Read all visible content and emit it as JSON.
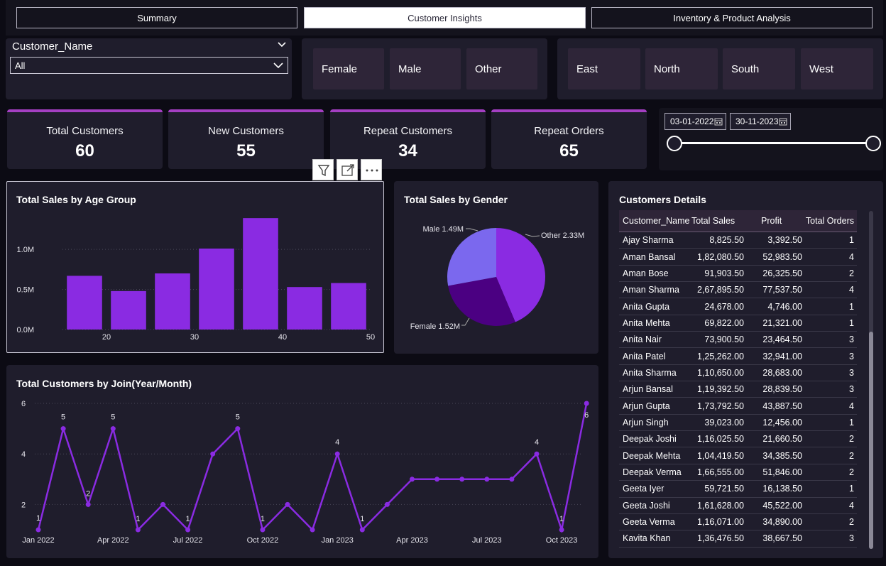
{
  "nav": {
    "tabs": [
      {
        "label": "Summary"
      },
      {
        "label": "Customer Insights"
      },
      {
        "label": "Inventory & Product Analysis"
      }
    ],
    "active": 1
  },
  "slicers": {
    "customer_label": "Customer_Name",
    "customer_value": "All",
    "gender": [
      "Female",
      "Male",
      "Other"
    ],
    "region": [
      "East",
      "North",
      "South",
      "West"
    ],
    "date_start": "03-01-2022",
    "date_end": "30-11-2023"
  },
  "kpis": [
    {
      "label": "Total Customers",
      "value": "60"
    },
    {
      "label": "New Customers",
      "value": "55"
    },
    {
      "label": "Repeat Customers",
      "value": "34"
    },
    {
      "label": "Repeat Orders",
      "value": "65"
    }
  ],
  "colors": {
    "accent": "#a43fc2",
    "bar": "#8a2be2",
    "pie_other": "#8a2be2",
    "pie_male": "#7b68ee",
    "pie_female": "#4b0082"
  },
  "age_chart": {
    "title": "Total Sales by Age Group",
    "chart_data": {
      "type": "bar",
      "ylim": [
        0,
        1400000
      ],
      "yticks": [
        {
          "v": 0,
          "label": "0.0M"
        },
        {
          "v": 500000,
          "label": "0.5M"
        },
        {
          "v": 1000000,
          "label": "1.0M"
        }
      ],
      "xticks": [
        "20",
        "30",
        "40",
        "50"
      ],
      "values": [
        670000,
        480000,
        700000,
        1010000,
        1390000,
        530000,
        580000
      ]
    }
  },
  "gender_chart": {
    "title": "Total Sales by Gender",
    "chart_data": {
      "type": "pie",
      "slices": [
        {
          "name": "Other",
          "value": 2.33,
          "label": "Other 2.33M"
        },
        {
          "name": "Female",
          "value": 1.52,
          "label": "Female 1.52M"
        },
        {
          "name": "Male",
          "value": 1.49,
          "label": "Male 1.49M"
        }
      ]
    }
  },
  "join_chart": {
    "title": "Total Customers by Join(Year/Month)",
    "chart_data": {
      "type": "line",
      "ylim": [
        1,
        6
      ],
      "yticks": [
        "2",
        "4",
        "6"
      ],
      "xticks": [
        "Jan 2022",
        "Apr 2022",
        "Jul 2022",
        "Oct 2022",
        "Jan 2023",
        "Apr 2023",
        "Jul 2023",
        "Oct 2023"
      ],
      "values": [
        1,
        5,
        2,
        5,
        1,
        2,
        1,
        4,
        5,
        1,
        2,
        1,
        4,
        1,
        2,
        3,
        3,
        3,
        3,
        3,
        4,
        1,
        6
      ],
      "labels": [
        "1",
        "5",
        "2",
        "5",
        "1",
        "",
        "1",
        "",
        "5",
        "1",
        "",
        "",
        "4",
        "1",
        "",
        "",
        "",
        "",
        "",
        "",
        "4",
        "1",
        "6"
      ]
    }
  },
  "table": {
    "title": "Customers Details",
    "headers": [
      "Customer_Name",
      "Total Sales",
      "Profit",
      "Total Orders"
    ],
    "rows": [
      [
        "Ajay Sharma",
        "8,825.50",
        "3,392.50",
        "1"
      ],
      [
        "Aman Bansal",
        "1,82,080.50",
        "52,983.50",
        "4"
      ],
      [
        "Aman Bose",
        "91,903.50",
        "26,325.50",
        "2"
      ],
      [
        "Aman Sharma",
        "2,67,895.50",
        "77,537.50",
        "4"
      ],
      [
        "Anita Gupta",
        "24,678.00",
        "4,746.00",
        "1"
      ],
      [
        "Anita Mehta",
        "69,822.00",
        "21,321.00",
        "1"
      ],
      [
        "Anita Nair",
        "73,900.50",
        "23,464.50",
        "3"
      ],
      [
        "Anita Patel",
        "1,25,262.00",
        "32,941.00",
        "3"
      ],
      [
        "Anita Sharma",
        "1,10,650.00",
        "28,683.00",
        "3"
      ],
      [
        "Arjun Bansal",
        "1,19,392.50",
        "28,839.50",
        "3"
      ],
      [
        "Arjun Gupta",
        "1,73,792.50",
        "43,887.50",
        "4"
      ],
      [
        "Arjun Singh",
        "39,023.00",
        "12,456.00",
        "1"
      ],
      [
        "Deepak Joshi",
        "1,16,025.50",
        "21,660.50",
        "2"
      ],
      [
        "Deepak Mehta",
        "1,04,419.50",
        "34,385.50",
        "2"
      ],
      [
        "Deepak Verma",
        "1,66,555.00",
        "51,846.00",
        "2"
      ],
      [
        "Geeta Iyer",
        "59,721.50",
        "16,138.50",
        "1"
      ],
      [
        "Geeta Joshi",
        "1,61,628.00",
        "45,522.00",
        "4"
      ],
      [
        "Geeta Verma",
        "1,16,071.00",
        "34,890.00",
        "2"
      ],
      [
        "Kavita Khan",
        "1,36,476.50",
        "38,667.50",
        "3"
      ]
    ]
  }
}
